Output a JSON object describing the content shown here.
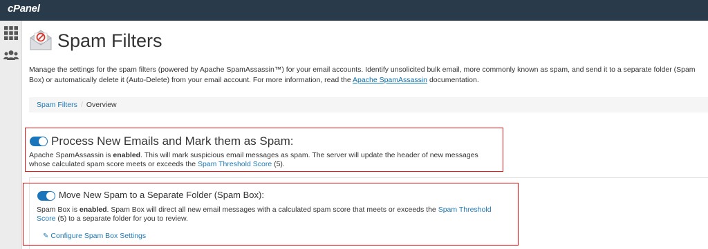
{
  "header": {
    "brand": "cPanel"
  },
  "sidebar": {
    "items": [
      {
        "icon": "apps-grid-icon"
      },
      {
        "icon": "users-icon"
      }
    ]
  },
  "page": {
    "title": "Spam Filters",
    "icon": "spam-envelope-icon",
    "description": {
      "text_before_link": "Manage the settings for the spam filters (powered by Apache SpamAssassin™) for your email accounts. Identify unsolicited bulk email, more commonly known as spam, and send it to a separate folder (Spam Box) or automatically delete it (Auto-Delete) from your email account. For more information, read the ",
      "link_text": "Apache SpamAssassin",
      "text_after_link": " documentation."
    }
  },
  "breadcrumb": {
    "items": [
      "Spam Filters",
      "Overview"
    ],
    "separator": "/"
  },
  "process": {
    "heading": "Process New Emails and Mark them as Spam:",
    "toggle_on": true,
    "text_a": "Apache SpamAssassin is ",
    "status": "enabled",
    "text_b": ". This will mark suspicious email messages as spam. The server will update the header of new messages whose calculated spam score meets or exceeds the ",
    "link": "Spam Threshold Score",
    "text_c": " (5)."
  },
  "spambox": {
    "heading": "Move New Spam to a Separate Folder (Spam Box):",
    "toggle_on": true,
    "text_a": "Spam Box is ",
    "status": "enabled",
    "text_b": ". Spam Box will direct all new email messages with a calculated spam score that meets or exceeds the ",
    "link": "Spam Threshold Score",
    "text_c": " (5) to a separate folder for you to review.",
    "configure_link": "Configure Spam Box Settings"
  },
  "colors": {
    "topbar": "#293a4a",
    "accent": "#1b75bb",
    "link": "#1c79b5",
    "highlight_border": "#ee1111"
  }
}
